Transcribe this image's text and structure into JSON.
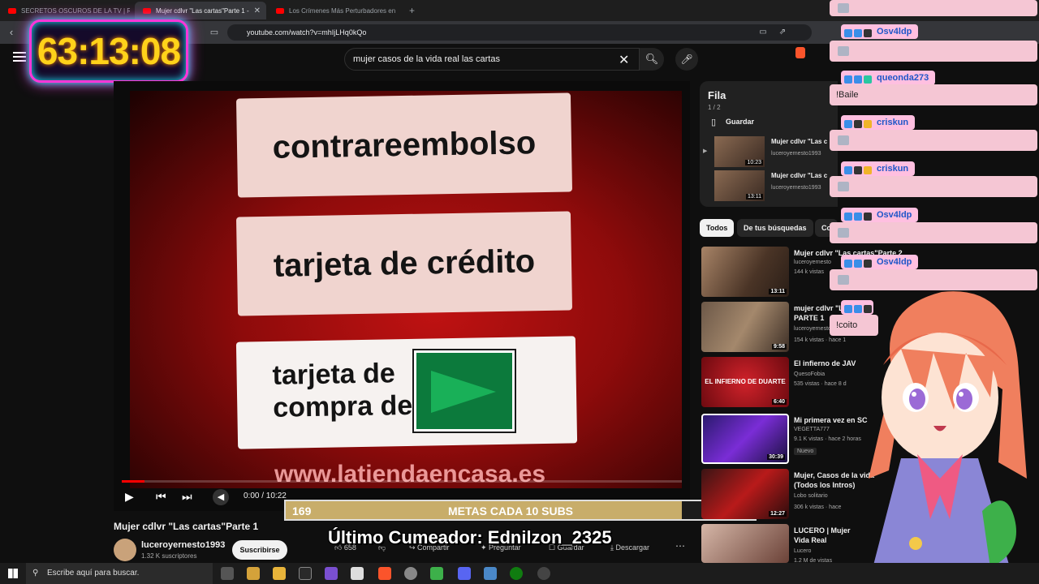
{
  "tabs": [
    {
      "label": "SECRETOS OSCUROS DE LA TV | REC"
    },
    {
      "label": "Mujer cdlvr \"Las cartas\"Parte 1 -"
    },
    {
      "label": "Los Crímenes Más Perturbadores en"
    }
  ],
  "address": {
    "url": "youtube.com/watch?v=mhIjLHq0kQo"
  },
  "search": {
    "value": "mujer casos de la vida real las cartas"
  },
  "timer": "63:13:08",
  "video": {
    "box1": "contrareembolso",
    "box2": "tarjeta de crédito",
    "box3_line1": "tarjeta de",
    "box3_line2": "compra de",
    "site": "www.latiendaencasa.es",
    "time": "0:00 / 10:22",
    "progress": 0.04
  },
  "goal": {
    "current": "169",
    "label": "METAS CADA 10 SUBS",
    "target": "200",
    "fill": 0.845
  },
  "overlay_text": "Último Cumeador: Ednilzon_2325",
  "meta": {
    "title": "Mujer cdlvr \"Las cartas\"Parte 1",
    "channel": "luceroyernesto1993",
    "subscribers": "1.32 K suscriptores",
    "subscribe": "Suscribirse",
    "likes": "658",
    "share": "Compartir",
    "ask": "Preguntar",
    "save": "Guardar",
    "download": "Descargar"
  },
  "queue": {
    "title": "Fila",
    "count": "1 / 2",
    "save": "Guardar",
    "items": [
      {
        "title": "Mujer cdlvr \"Las c",
        "channel": "luceroyernesto1993",
        "duration": "10:23"
      },
      {
        "title": "Mujer cdlvr \"Las c",
        "channel": "luceroyernesto1993",
        "duration": "13:11"
      }
    ]
  },
  "chips": [
    "Todos",
    "De tus búsquedas",
    "Co"
  ],
  "recs": [
    {
      "title": "Mujer cdlvr \"Las cartas\"Parte 2",
      "channel": "luceroyernesto",
      "meta": "144 k vistas",
      "duration": "13:11"
    },
    {
      "title": "mujer cdlvr \"L",
      "title2": "PARTE 1",
      "channel": "luceroyernesto",
      "meta": "154 k vistas · hace 1",
      "duration": "9:58"
    },
    {
      "title": "El infierno de JAV",
      "channel": "QuesoFobia",
      "meta": "535 vistas · hace 8 d",
      "duration": "6:40",
      "thumb_text": "EL INFIERNO DE DUARTE"
    },
    {
      "title": "Mi primera vez en SC",
      "channel": "VEGETTA777",
      "meta": "9.1 K vistas · hace 2 horas",
      "duration": "30:39",
      "badge": "Nuevo"
    },
    {
      "title": "Mujer, Casos de la vida",
      "title2": "(Todos los Intros)",
      "channel": "Lobo solitario",
      "meta": "306 k vistas · hace",
      "duration": "12:27"
    },
    {
      "title": "LUCERO | Mujer",
      "title2": "Vida Real",
      "channel": "Lucero",
      "meta": "1.2 M de vistas",
      "duration": ""
    }
  ],
  "chat": [
    {
      "user": "Osv4ldp",
      "text": ""
    },
    {
      "user": "queonda273",
      "text": "!Baile"
    },
    {
      "user": "criskun",
      "text": ""
    },
    {
      "user": "criskun",
      "text": ""
    },
    {
      "user": "Osv4ldp",
      "text": ""
    },
    {
      "user": "Osv4ldp",
      "text": ""
    },
    {
      "user": "",
      "text": "!coito"
    }
  ],
  "taskbar": {
    "search_placeholder": "Escribe aquí para buscar."
  },
  "colors": {
    "accent": "#ff0000",
    "chat_bg": "#f5c6d4",
    "timer_digits": "#ffd21a",
    "timer_border": "#ff36d9"
  }
}
